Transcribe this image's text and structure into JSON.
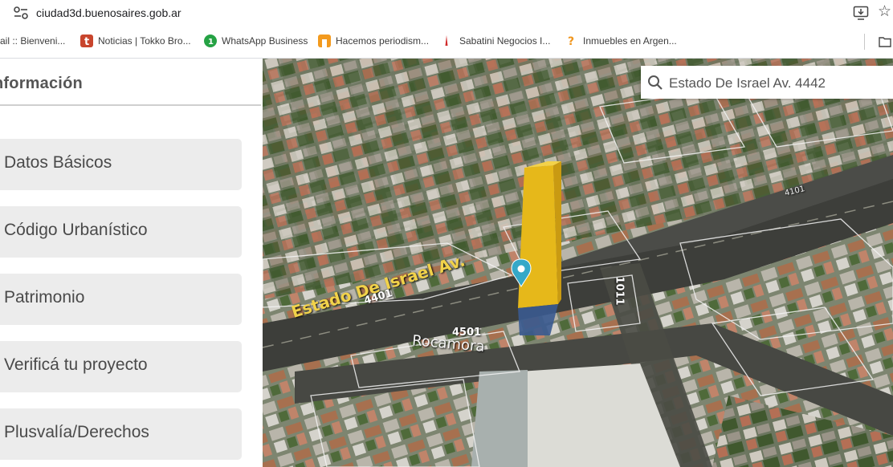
{
  "browser": {
    "url": "ciudad3d.buenosaires.gob.ar",
    "bookmarks": [
      {
        "label": "ail :: Bienveni...",
        "icon": "mail-icon",
        "color": ""
      },
      {
        "label": "Noticias | Tokko Bro...",
        "icon": "tokko-icon",
        "color": "#c8452d"
      },
      {
        "label": "WhatsApp Business",
        "icon": "whatsapp-business-icon",
        "color": "#25a244"
      },
      {
        "label": "Hacemos periodism...",
        "icon": "periodismo-icon",
        "color": "#f39a1e"
      },
      {
        "label": "Sabatini Negocios I...",
        "icon": "sabatini-icon",
        "color": "#d12b2b"
      },
      {
        "label": "Inmuebles en Argen...",
        "icon": "inmuebles-icon",
        "color": "#f0961e"
      }
    ]
  },
  "panel": {
    "title": "nformación",
    "items": [
      {
        "label": "Datos Básicos"
      },
      {
        "label": "Código Urbanístico"
      },
      {
        "label": "Patrimonio"
      },
      {
        "label": "Verificá tu proyecto"
      },
      {
        "label": "Plusvalía/Derechos"
      }
    ]
  },
  "map": {
    "search_value": "Estado De Israel Av. 4442",
    "street_labels": {
      "main_street": "Estado De Israel Av.",
      "number_4401": "4401",
      "cross_street": "Rocamora",
      "number_4501": "4501",
      "number_1011": "1011",
      "number_4101": "4101"
    },
    "colors": {
      "highlight_volume": "#e6b81a",
      "marker": "#35a8c8"
    }
  }
}
